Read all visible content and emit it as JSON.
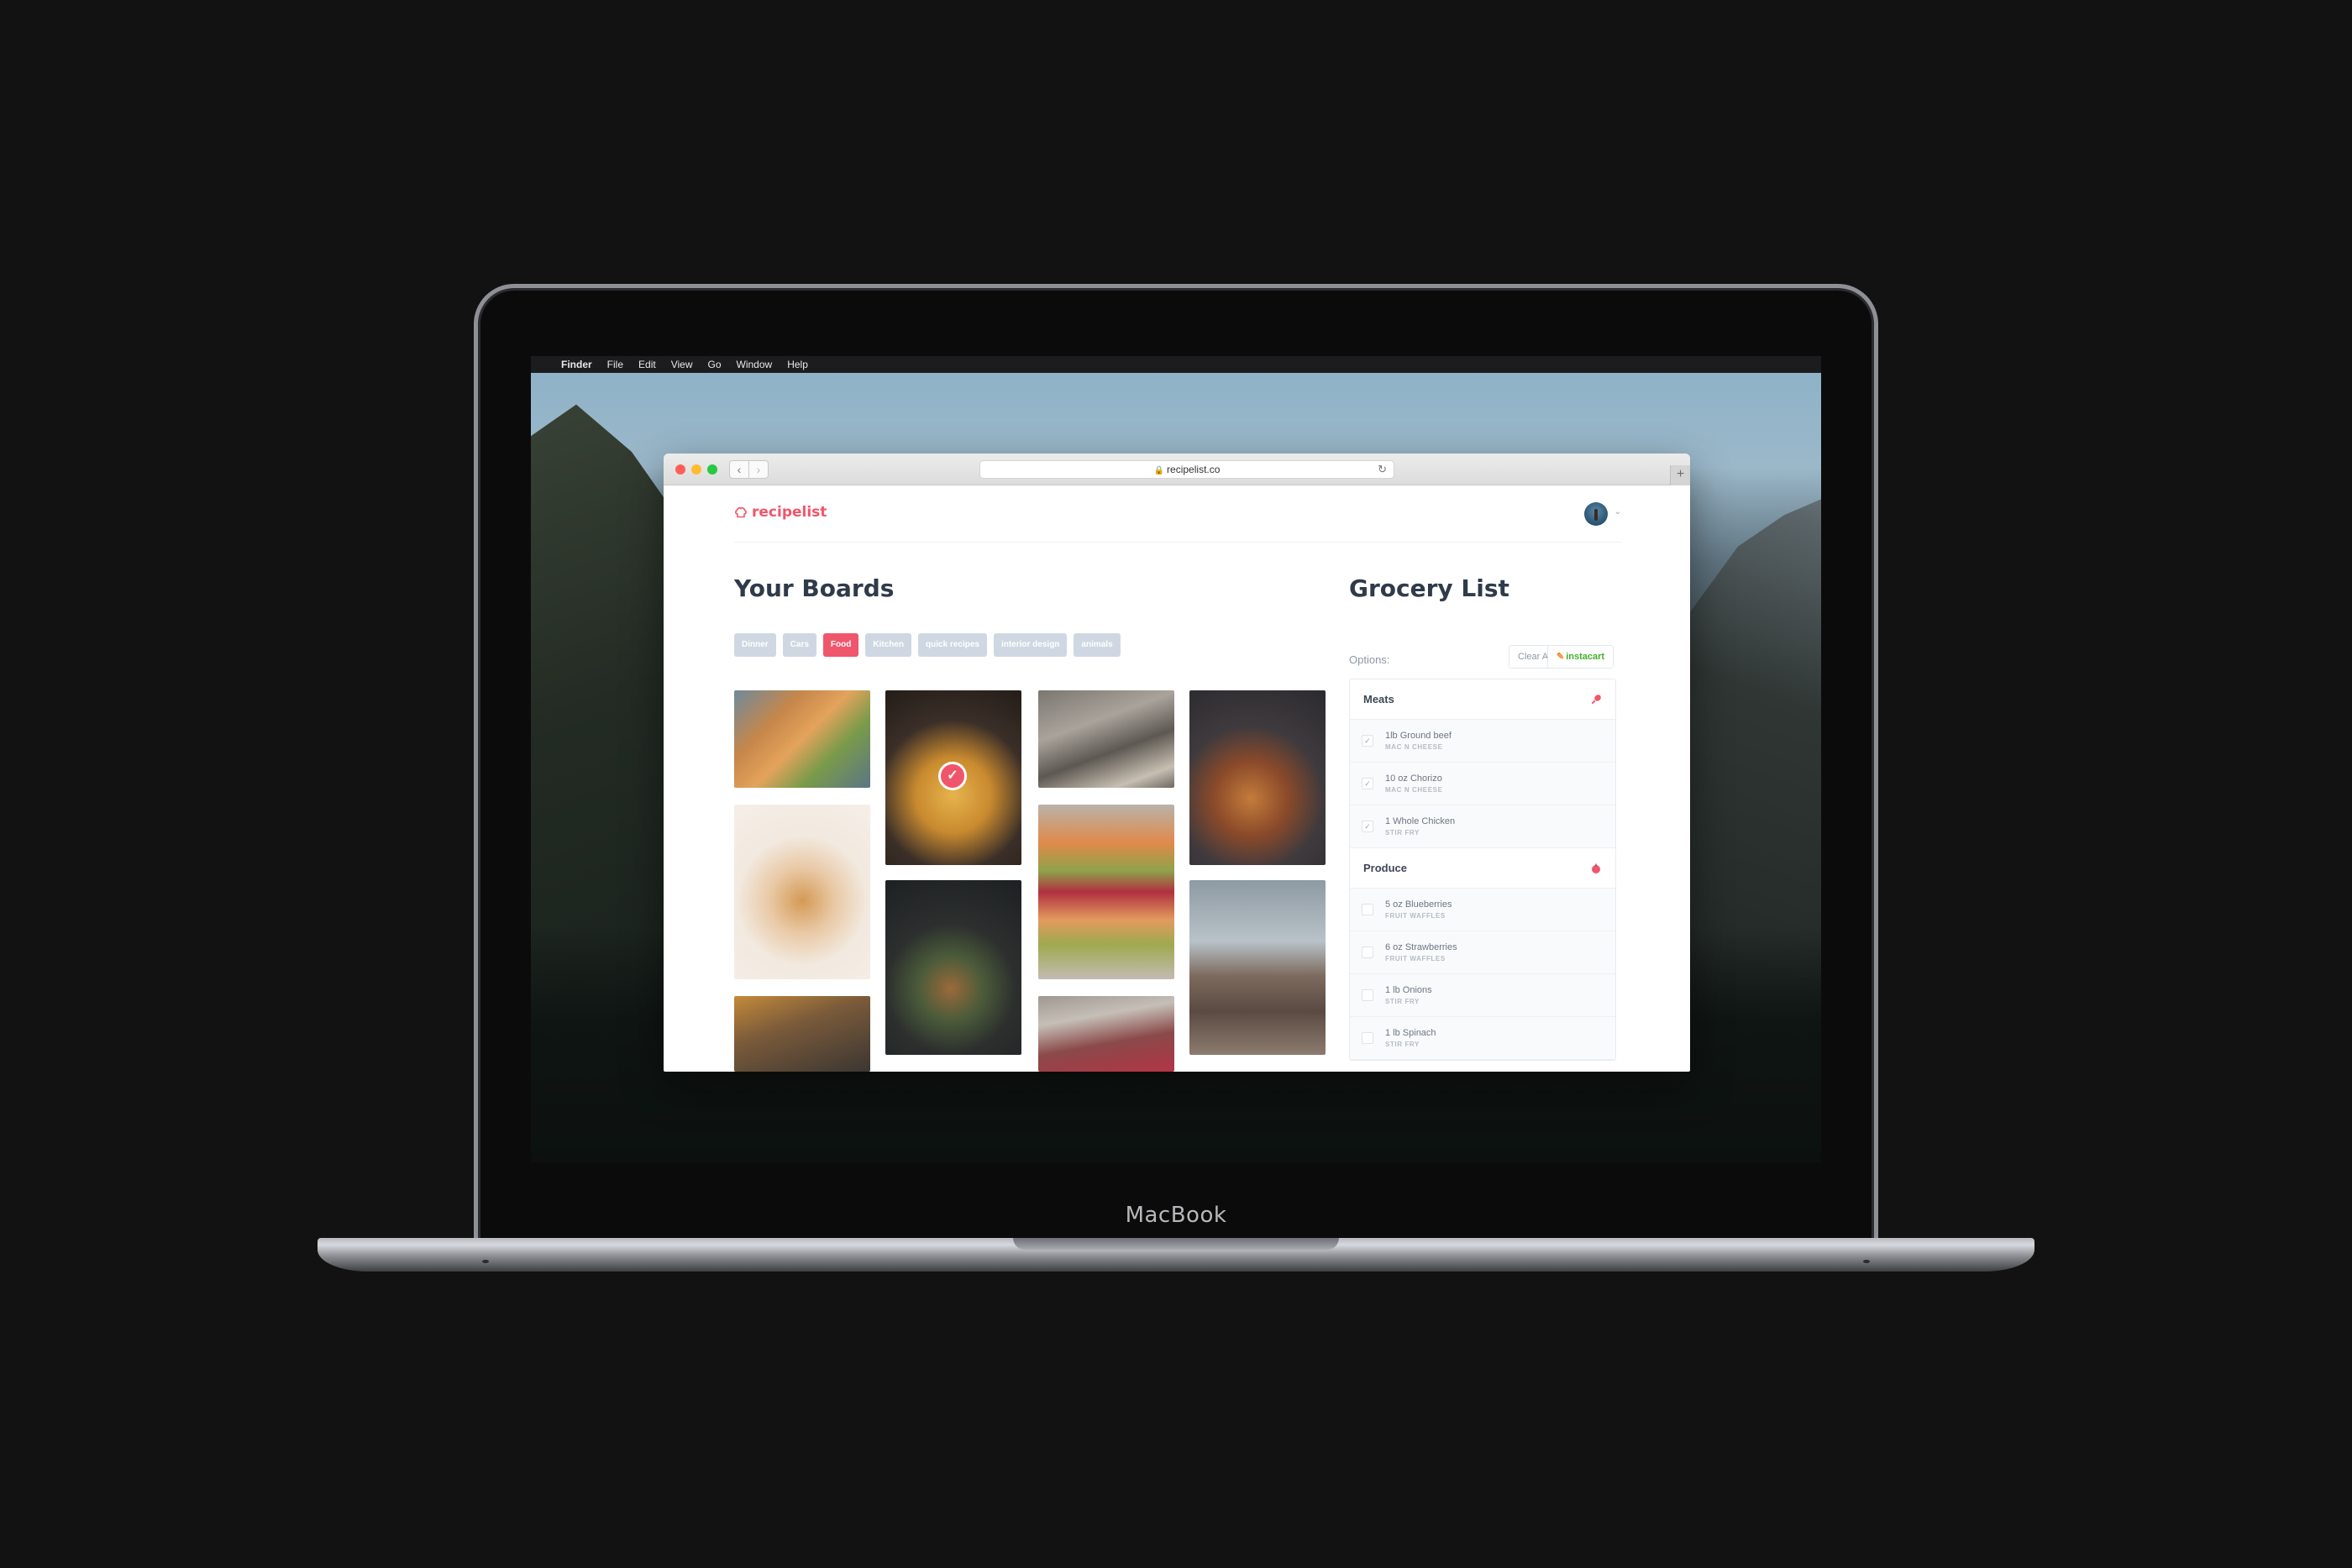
{
  "device": {
    "brand": "MacBook"
  },
  "menubar": {
    "apple_icon": "apple-logo-icon",
    "items": [
      "Finder",
      "File",
      "Edit",
      "View",
      "Go",
      "Window",
      "Help"
    ]
  },
  "browser": {
    "url": "recipelist.co",
    "back_icon": "chevron-left-icon",
    "forward_icon": "chevron-right-icon",
    "reload_icon": "reload-icon",
    "lock_icon": "lock-icon",
    "new_tab": "+"
  },
  "app": {
    "logo": "recipelist",
    "accent_color": "#f0566b",
    "boards": {
      "title": "Your Boards",
      "tags": [
        {
          "label": "Dinner",
          "active": false
        },
        {
          "label": "Cars",
          "active": false
        },
        {
          "label": "Food",
          "active": true
        },
        {
          "label": "Kitchen",
          "active": false
        },
        {
          "label": "quick recipes",
          "active": false
        },
        {
          "label": "interior design",
          "active": false
        },
        {
          "label": "animals",
          "active": false
        }
      ],
      "images": [
        "grilled-chicken-skewers",
        "pasta-on-fork",
        "coffee-table-flatlay",
        "berry-pancakes",
        "cheese-board",
        "toast-with-pomegranate",
        "skillet-chicken",
        "powdered-donuts",
        "honey-jar",
        "pomegranate-bowl"
      ],
      "selected_badge": "✓"
    },
    "grocery": {
      "title": "Grocery List",
      "options_label": "Options:",
      "clear_all": "Clear All",
      "instacart": "instacart",
      "categories": [
        {
          "name": "Meats",
          "icon": "drumstick-icon",
          "items": [
            {
              "name": "1lb Ground beef",
              "recipe": "MAC N CHEESE",
              "checked": true
            },
            {
              "name": "10 oz Chorizo",
              "recipe": "MAC N CHEESE",
              "checked": true
            },
            {
              "name": "1 Whole Chicken",
              "recipe": "STIR FRY",
              "checked": true
            }
          ]
        },
        {
          "name": "Produce",
          "icon": "apple-icon",
          "items": [
            {
              "name": "5 oz Blueberries",
              "recipe": "FRUIT WAFFLES",
              "checked": false
            },
            {
              "name": "6 oz Strawberries",
              "recipe": "FRUIT WAFFLES",
              "checked": false
            },
            {
              "name": "1 lb Onions",
              "recipe": "STIR FRY",
              "checked": false
            },
            {
              "name": "1 lb Spinach",
              "recipe": "STIR FRY",
              "checked": false
            }
          ]
        }
      ]
    }
  }
}
